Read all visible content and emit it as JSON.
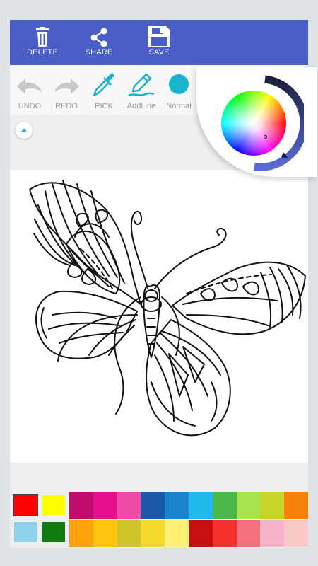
{
  "header": {
    "delete_label": "DELETE",
    "share_label": "SHARE",
    "save_label": "SAVE",
    "bg_color": "#4a5ec8"
  },
  "tools": {
    "undo_label": "UNDO",
    "redo_label": "REDO",
    "pick_label": "PICK",
    "addline_label": "AddLine",
    "normal_label": "Normal",
    "accent_color": "#1ab2cc"
  },
  "palette": {
    "current_colors": [
      "#ff0000",
      "#ffff00",
      "#8fd0ec",
      "#117a11"
    ],
    "row1": [
      "#c00b6f",
      "#e5108b",
      "#f04ca7",
      "#1e59a8",
      "#1a84cf",
      "#21b8ee",
      "#4bb749",
      "#a6e24a",
      "#c7d42c",
      "#f6820b"
    ],
    "row2": [
      "#ffa10a",
      "#ffc40e",
      "#cfc42c",
      "#f5d92c",
      "#fff176",
      "#c80e0e",
      "#f6302b",
      "#f56f7f",
      "#f7b3c7",
      "#f8c9c7"
    ]
  },
  "picker": {
    "ring_colors": [
      "#1a1e3c",
      "#5a6ad8"
    ]
  }
}
